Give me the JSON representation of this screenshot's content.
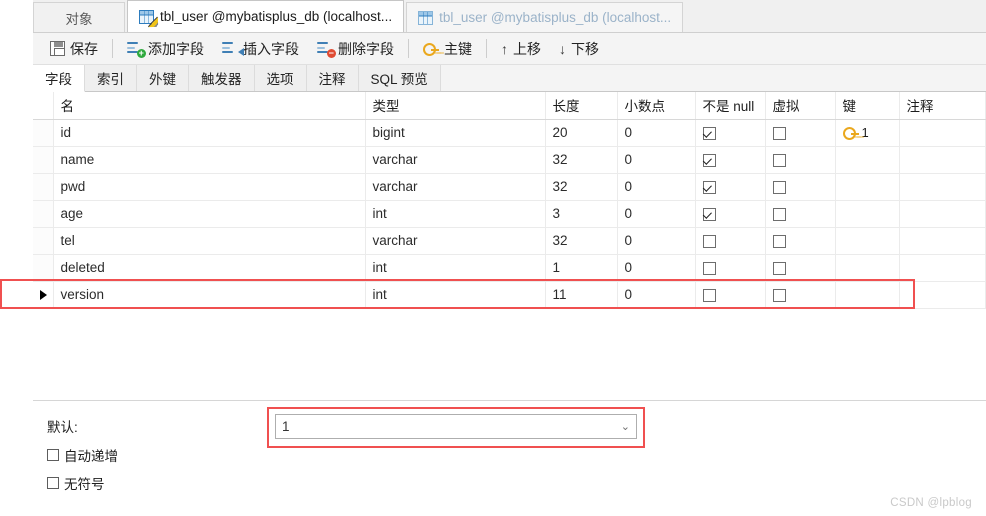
{
  "tabs": [
    {
      "label": "对象",
      "icon": "",
      "state": "object"
    },
    {
      "label": "tbl_user @mybatisplus_db (localhost...",
      "icon": "table-design-icon",
      "state": "active"
    },
    {
      "label": "tbl_user @mybatisplus_db (localhost...",
      "icon": "table-grid-icon",
      "state": "inactive"
    }
  ],
  "toolbar": {
    "save_label": "保存",
    "add_field_label": "添加字段",
    "insert_field_label": "插入字段",
    "delete_field_label": "删除字段",
    "primary_key_label": "主键",
    "move_up_label": "上移",
    "move_down_label": "下移",
    "move_up_glyph": "↑",
    "move_down_glyph": "↓"
  },
  "subtabs": [
    {
      "label": "字段",
      "active": true
    },
    {
      "label": "索引",
      "active": false
    },
    {
      "label": "外键",
      "active": false
    },
    {
      "label": "触发器",
      "active": false
    },
    {
      "label": "选项",
      "active": false
    },
    {
      "label": "注释",
      "active": false
    },
    {
      "label": "SQL 预览",
      "active": false
    }
  ],
  "grid": {
    "columns": [
      "名",
      "类型",
      "长度",
      "小数点",
      "不是 null",
      "虚拟",
      "键",
      "注释"
    ],
    "rows": [
      {
        "name": "id",
        "type": "bigint",
        "length": "20",
        "decimals": "0",
        "not_null": true,
        "virtual": false,
        "key": "1",
        "comment": "",
        "selected": false
      },
      {
        "name": "name",
        "type": "varchar",
        "length": "32",
        "decimals": "0",
        "not_null": true,
        "virtual": false,
        "key": "",
        "comment": "",
        "selected": false
      },
      {
        "name": "pwd",
        "type": "varchar",
        "length": "32",
        "decimals": "0",
        "not_null": true,
        "virtual": false,
        "key": "",
        "comment": "",
        "selected": false
      },
      {
        "name": "age",
        "type": "int",
        "length": "3",
        "decimals": "0",
        "not_null": true,
        "virtual": false,
        "key": "",
        "comment": "",
        "selected": false
      },
      {
        "name": "tel",
        "type": "varchar",
        "length": "32",
        "decimals": "0",
        "not_null": false,
        "virtual": false,
        "key": "",
        "comment": "",
        "selected": false
      },
      {
        "name": "deleted",
        "type": "int",
        "length": "1",
        "decimals": "0",
        "not_null": false,
        "virtual": false,
        "key": "",
        "comment": "",
        "selected": false
      },
      {
        "name": "version",
        "type": "int",
        "length": "11",
        "decimals": "0",
        "not_null": false,
        "virtual": false,
        "key": "",
        "comment": "",
        "selected": true
      }
    ]
  },
  "properties": {
    "default_label": "默认:",
    "default_value": "1",
    "chevron_glyph": "⌄",
    "auto_increment_label": "自动递增",
    "auto_increment_checked": false,
    "unsigned_label": "无符号",
    "unsigned_checked": false
  },
  "annotations": {
    "highlight_color": "#f05050",
    "row_highlight_target": "version",
    "combo_highlight_target": "默认:"
  },
  "watermark": "CSDN @lpblog"
}
